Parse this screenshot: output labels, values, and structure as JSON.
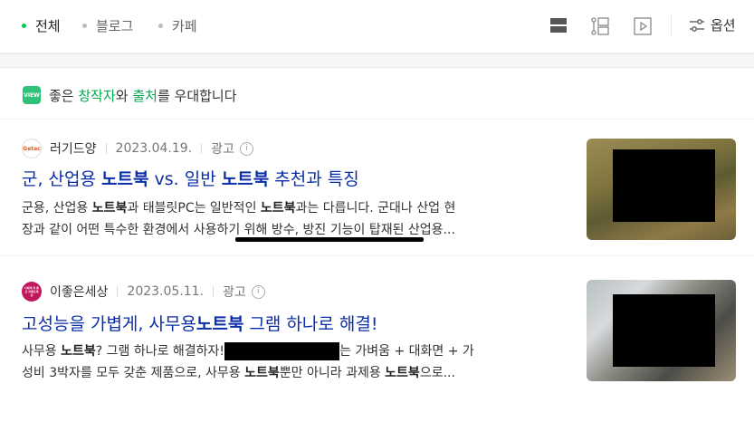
{
  "tabs": {
    "all": "전체",
    "blog": "블로그",
    "cafe": "카페",
    "options": "옵션"
  },
  "view_icons": [
    "list-view-icon",
    "card-view-icon",
    "video-view-icon"
  ],
  "banner": {
    "badge": "VIEW",
    "text_1": "좋은 ",
    "creator": "창작자",
    "text_2": "와 ",
    "source": "출처",
    "text_3": "를 우대합니다"
  },
  "results": [
    {
      "avatar_text": "Getac",
      "author": "러기드양",
      "date": "2023.04.19.",
      "ad": "광고",
      "info": "i",
      "title_parts": [
        "군, 산업용 ",
        "노트북",
        " vs. 일반 ",
        "노트북",
        " 추천과 특징"
      ],
      "desc_line1": [
        "군용, 산업용 ",
        "노트북",
        "과 태블릿PC는 일반적인 ",
        "노트북",
        "과는 다릅니다. 군대나 산업 현"
      ],
      "desc_line2": "장과 같이 어떤 특수한 환경에서 사용하기 위해 방수, 방진 기능이 탑재된 산업용..."
    },
    {
      "avatar_text": "나에게 꼭 좋은 이좋은세상",
      "author": "이좋은세상",
      "date": "2023.05.11.",
      "ad": "광고",
      "info": "i",
      "title_parts": [
        "고성능을 가볍게, 사무용",
        "노트북",
        " 그램 하나로 해결!"
      ],
      "desc_line1": [
        "사무용 ",
        "노트북",
        "? 그램 하나로 해결하자!",
        "",
        "는 가벼움 + 대화면 + 가"
      ],
      "desc_line2_parts": [
        "성비 3박자를 모두 갖춘 제품으로, 사무용 ",
        "노트북",
        "뿐만 아니라 과제용 ",
        "노트북",
        "으로..."
      ]
    }
  ],
  "colors": {
    "accent_green": "#03c75a",
    "title_blue": "#0b2ea8"
  }
}
